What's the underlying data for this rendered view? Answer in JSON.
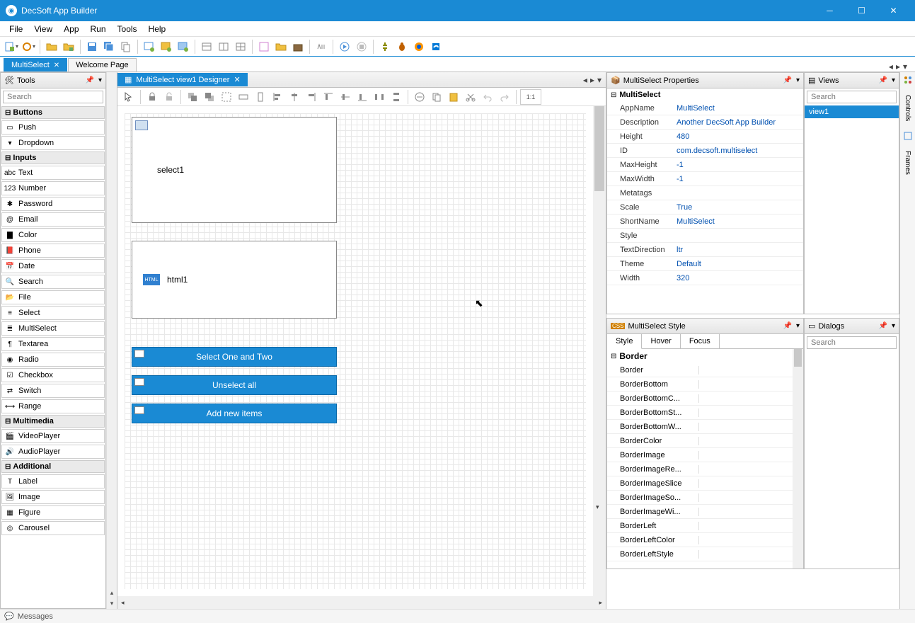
{
  "titlebar": {
    "title": "DecSoft App Builder"
  },
  "menu": [
    "File",
    "View",
    "App",
    "Run",
    "Tools",
    "Help"
  ],
  "doc_tabs": {
    "active": "MultiSelect",
    "inactive": "Welcome Page"
  },
  "tools_panel": {
    "title": "Tools",
    "search_placeholder": "Search",
    "categories": {
      "buttons": "Buttons",
      "inputs": "Inputs",
      "multimedia": "Multimedia",
      "additional": "Additional"
    },
    "buttons": [
      "Push",
      "Dropdown"
    ],
    "inputs": [
      "Text",
      "Number",
      "Password",
      "Email",
      "Color",
      "Phone",
      "Date",
      "Search",
      "File",
      "Select",
      "MultiSelect",
      "Textarea",
      "Radio",
      "Checkbox",
      "Switch",
      "Range"
    ],
    "multimedia": [
      "VideoPlayer",
      "AudioPlayer"
    ],
    "additional": [
      "Label",
      "Image",
      "Figure",
      "Carousel"
    ]
  },
  "designer": {
    "tab": "MultiSelect view1 Designer",
    "widgets": {
      "select1": "select1",
      "html1": "html1",
      "btn1": "Select One and Two",
      "btn2": "Unselect all",
      "btn3": "Add new items"
    }
  },
  "props": {
    "title": "MultiSelect Properties",
    "header": "MultiSelect",
    "rows": [
      {
        "name": "AppName",
        "val": "MultiSelect"
      },
      {
        "name": "Description",
        "val": "Another DecSoft App Builder"
      },
      {
        "name": "Height",
        "val": "480"
      },
      {
        "name": "ID",
        "val": "com.decsoft.multiselect"
      },
      {
        "name": "MaxHeight",
        "val": "-1"
      },
      {
        "name": "MaxWidth",
        "val": "-1"
      },
      {
        "name": "Metatags",
        "val": ""
      },
      {
        "name": "Scale",
        "val": "True"
      },
      {
        "name": "ShortName",
        "val": "MultiSelect"
      },
      {
        "name": "Style",
        "val": ""
      },
      {
        "name": "TextDirection",
        "val": "ltr"
      },
      {
        "name": "Theme",
        "val": "Default"
      },
      {
        "name": "Width",
        "val": "320"
      }
    ]
  },
  "views": {
    "title": "Views",
    "search_placeholder": "Search",
    "items": [
      "view1"
    ]
  },
  "style_panel": {
    "title": "MultiSelect Style",
    "tabs": [
      "Style",
      "Hover",
      "Focus"
    ],
    "header": "Border",
    "rows": [
      "Border",
      "BorderBottom",
      "BorderBottomC...",
      "BorderBottomSt...",
      "BorderBottomW...",
      "BorderColor",
      "BorderImage",
      "BorderImageRe...",
      "BorderImageSlice",
      "BorderImageSo...",
      "BorderImageWi...",
      "BorderLeft",
      "BorderLeftColor",
      "BorderLeftStyle"
    ]
  },
  "dialogs": {
    "title": "Dialogs",
    "search_placeholder": "Search"
  },
  "side_tabs": [
    "Controls",
    "Frames"
  ],
  "statusbar": {
    "messages": "Messages"
  }
}
